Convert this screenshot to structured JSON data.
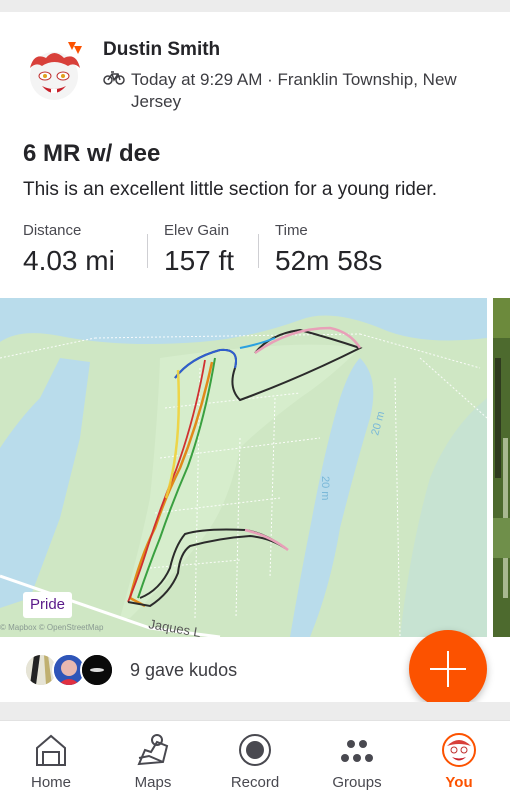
{
  "activity": {
    "athlete": "Dustin Smith",
    "sport_icon": "bike-icon",
    "time_location": "Today at 9:29 AM · Franklin Township, New Jersey",
    "title": "6 MR w/ dee",
    "description": "This is an excellent little section for a young rider.",
    "stats": [
      {
        "label": "Distance",
        "value": "4.03 mi"
      },
      {
        "label": "Elev Gain",
        "value": "157 ft"
      },
      {
        "label": "Time",
        "value": "52m 58s"
      }
    ]
  },
  "map": {
    "badge": "Pride",
    "attribution": "© Mapbox © OpenStreetMap",
    "labels": {
      "road": "Jaques L",
      "contour1": "20 m",
      "contour2": "20 m"
    },
    "colors": {
      "land": "#cfe7c4",
      "water": "#b9dceb"
    }
  },
  "kudos": {
    "text": "9 gave kudos"
  },
  "fab": {
    "icon": "plus-icon",
    "color": "#fc5200"
  },
  "nav": {
    "tabs": [
      {
        "label": "Home",
        "icon": "home-icon"
      },
      {
        "label": "Maps",
        "icon": "maps-icon"
      },
      {
        "label": "Record",
        "icon": "record-icon"
      },
      {
        "label": "Groups",
        "icon": "groups-icon"
      },
      {
        "label": "You",
        "icon": "profile-avatar-icon",
        "active": true
      }
    ],
    "accent": "#fc5200"
  }
}
